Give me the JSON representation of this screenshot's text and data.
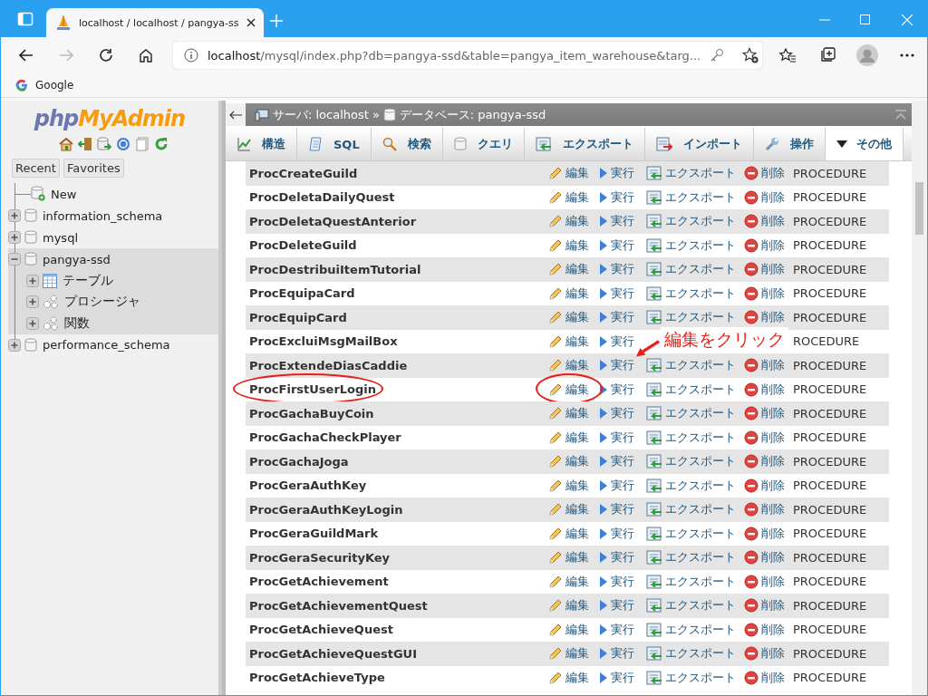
{
  "browser": {
    "tab_title": "localhost / localhost / pangya-ss",
    "address": {
      "host": "localhost",
      "path": "/mysql/index.php?db=pangya-ssd&table=pangya_item_warehouse&targ..."
    },
    "bookmarks": [
      "Google"
    ]
  },
  "sidebar": {
    "logo": {
      "php": "php",
      "myadmin": "MyAdmin"
    },
    "buttons": [
      "Recent",
      "Favorites"
    ],
    "tree": [
      {
        "label": "New",
        "kind": "new"
      },
      {
        "label": "information_schema",
        "kind": "db",
        "expanded": false,
        "selected": false
      },
      {
        "label": "mysql",
        "kind": "db",
        "expanded": false,
        "selected": false
      },
      {
        "label": "pangya-ssd",
        "kind": "db",
        "expanded": true,
        "selected": true,
        "children": [
          {
            "label": "テーブル",
            "kind": "table",
            "expanded": false
          },
          {
            "label": "プロシージャ",
            "kind": "routine",
            "expanded": false
          },
          {
            "label": "関数",
            "kind": "routine",
            "expanded": false
          }
        ]
      },
      {
        "label": "performance_schema",
        "kind": "db",
        "expanded": false,
        "selected": false
      }
    ]
  },
  "breadcrumb": {
    "server": "サーバ: localhost",
    "separator": "»",
    "database": "データベース: pangya-ssd"
  },
  "tabs": [
    {
      "label": "構造",
      "kind": "structure"
    },
    {
      "label": "SQL",
      "kind": "sql"
    },
    {
      "label": "検索",
      "kind": "search"
    },
    {
      "label": "クエリ",
      "kind": "query"
    },
    {
      "label": "エクスポート",
      "kind": "export"
    },
    {
      "label": "インポート",
      "kind": "import"
    },
    {
      "label": "操作",
      "kind": "operations"
    },
    {
      "label": "その他",
      "kind": "more"
    }
  ],
  "routines": [
    {
      "name": "ProcCreateGuild",
      "actions": [
        "編集",
        "実行",
        "エクスポート",
        "削除"
      ],
      "type": "PROCEDURE",
      "highlighted": false
    },
    {
      "name": "ProcDeletaDailyQuest",
      "actions": [
        "編集",
        "実行",
        "エクスポート",
        "削除"
      ],
      "type": "PROCEDURE",
      "highlighted": false
    },
    {
      "name": "ProcDeletaQuestAnterior",
      "actions": [
        "編集",
        "実行",
        "エクスポート",
        "削除"
      ],
      "type": "PROCEDURE",
      "highlighted": false
    },
    {
      "name": "ProcDeleteGuild",
      "actions": [
        "編集",
        "実行",
        "エクスポート",
        "削除"
      ],
      "type": "PROCEDURE",
      "highlighted": false
    },
    {
      "name": "ProcDestribuiItemTutorial",
      "actions": [
        "編集",
        "実行",
        "エクスポート",
        "削除"
      ],
      "type": "PROCEDURE",
      "highlighted": false
    },
    {
      "name": "ProcEquipaCard",
      "actions": [
        "編集",
        "実行",
        "エクスポート",
        "削除"
      ],
      "type": "PROCEDURE",
      "highlighted": false
    },
    {
      "name": "ProcEquipCard",
      "actions": [
        "編集",
        "実行",
        "エクスポート",
        "削除"
      ],
      "type": "PROCEDURE",
      "highlighted": false
    },
    {
      "name": "ProcExcluiMsgMailBox",
      "actions": [
        "編集",
        "実行"
      ],
      "type": "ROCEDURE",
      "highlighted": false
    },
    {
      "name": "ProcExtendeDiasCaddie",
      "actions": [
        "編集",
        "実行",
        "エクスポート",
        "削除"
      ],
      "type": "PROCEDURE",
      "highlighted": false
    },
    {
      "name": "ProcFirstUserLogin",
      "actions": [
        "編集",
        "実行",
        "エクスポート",
        "削除"
      ],
      "type": "PROCEDURE",
      "highlighted": true
    },
    {
      "name": "ProcGachaBuyCoin",
      "actions": [
        "編集",
        "実行",
        "エクスポート",
        "削除"
      ],
      "type": "PROCEDURE",
      "highlighted": false
    },
    {
      "name": "ProcGachaCheckPlayer",
      "actions": [
        "編集",
        "実行",
        "エクスポート",
        "削除"
      ],
      "type": "PROCEDURE",
      "highlighted": false
    },
    {
      "name": "ProcGachaJoga",
      "actions": [
        "編集",
        "実行",
        "エクスポート",
        "削除"
      ],
      "type": "PROCEDURE",
      "highlighted": false
    },
    {
      "name": "ProcGeraAuthKey",
      "actions": [
        "編集",
        "実行",
        "エクスポート",
        "削除"
      ],
      "type": "PROCEDURE",
      "highlighted": false
    },
    {
      "name": "ProcGeraAuthKeyLogin",
      "actions": [
        "編集",
        "実行",
        "エクスポート",
        "削除"
      ],
      "type": "PROCEDURE",
      "highlighted": false
    },
    {
      "name": "ProcGeraGuildMark",
      "actions": [
        "編集",
        "実行",
        "エクスポート",
        "削除"
      ],
      "type": "PROCEDURE",
      "highlighted": false
    },
    {
      "name": "ProcGeraSecurityKey",
      "actions": [
        "編集",
        "実行",
        "エクスポート",
        "削除"
      ],
      "type": "PROCEDURE",
      "highlighted": false
    },
    {
      "name": "ProcGetAchievement",
      "actions": [
        "編集",
        "実行",
        "エクスポート",
        "削除"
      ],
      "type": "PROCEDURE",
      "highlighted": false
    },
    {
      "name": "ProcGetAchievementQuest",
      "actions": [
        "編集",
        "実行",
        "エクスポート",
        "削除"
      ],
      "type": "PROCEDURE",
      "highlighted": false
    },
    {
      "name": "ProcGetAchieveQuest",
      "actions": [
        "編集",
        "実行",
        "エクスポート",
        "削除"
      ],
      "type": "PROCEDURE",
      "highlighted": false
    },
    {
      "name": "ProcGetAchieveQuestGUI",
      "actions": [
        "編集",
        "実行",
        "エクスポート",
        "削除"
      ],
      "type": "PROCEDURE",
      "highlighted": false
    },
    {
      "name": "ProcGetAchieveType",
      "actions": [
        "編集",
        "実行",
        "エクスポート",
        "削除"
      ],
      "type": "PROCEDURE",
      "highlighted": false
    }
  ],
  "annotation": {
    "text": "編集をクリック"
  }
}
